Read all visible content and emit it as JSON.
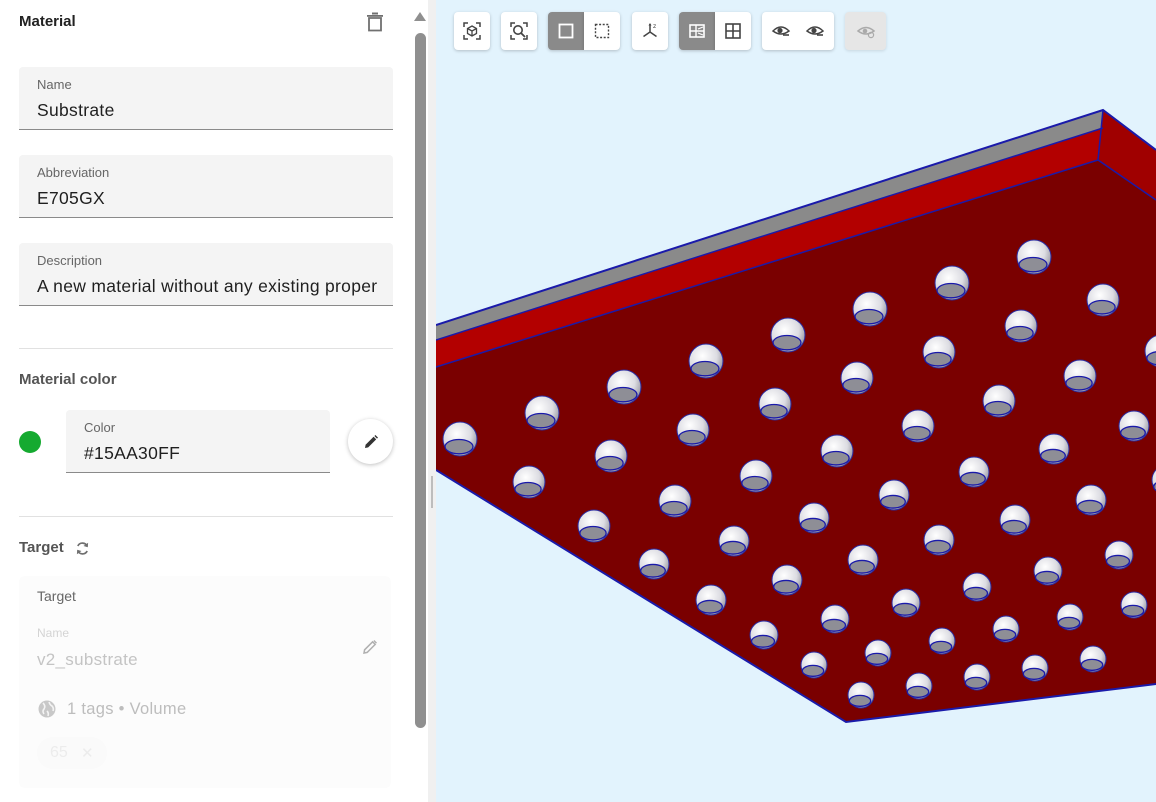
{
  "material": {
    "section_title": "Material",
    "name": {
      "label": "Name",
      "value": "Substrate"
    },
    "abbreviation": {
      "label": "Abbreviation",
      "value": "E705GX"
    },
    "description": {
      "label": "Description",
      "value": "A new material without any existing properties"
    }
  },
  "material_color": {
    "section_title": "Material color",
    "color": {
      "label": "Color",
      "value": "#15AA30FF"
    },
    "swatch_color": "#15AA30"
  },
  "target": {
    "section_title": "Target",
    "card_label": "Target",
    "name_label": "Name",
    "name_value": "v2_substrate",
    "tags_text": "1 tags • Volume",
    "chip_value": "65",
    "chip_close": "✕"
  },
  "toolbar": {
    "icons": [
      "fit-all-icon",
      "zoom-fit-icon",
      "select-box-icon",
      "select-dashed-icon",
      "axes-icon",
      "section-view-icon",
      "grid-view-icon",
      "eye-hide-icon",
      "eye-show-icon",
      "eye-disabled-icon"
    ]
  },
  "scene": {
    "substrate_top_color": "#7a0000",
    "substrate_side_color": "#b30000",
    "substrate_edge_color": "#8a8a8a",
    "outline_color": "#1a1aaa",
    "background_color": "#e2f3fd"
  }
}
